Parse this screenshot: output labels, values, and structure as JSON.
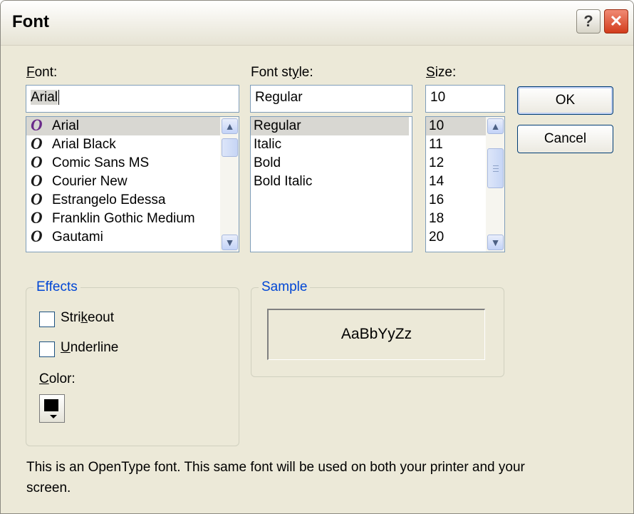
{
  "window": {
    "title": "Font",
    "help_glyph": "?",
    "close_glyph": "✕"
  },
  "font": {
    "label_mnemonic": "F",
    "label_rest": "ont:",
    "value": "Arial",
    "items": [
      "Arial",
      "Arial Black",
      "Comic Sans MS",
      "Courier New",
      "Estrangelo Edessa",
      "Franklin Gothic Medium",
      "Gautami"
    ],
    "selected": "Arial",
    "icon": "opentype-icon"
  },
  "font_style": {
    "label_pre": "Font st",
    "label_mnemonic": "y",
    "label_rest": "le:",
    "value": "Regular",
    "items": [
      "Regular",
      "Italic",
      "Bold",
      "Bold Italic"
    ],
    "selected": "Regular"
  },
  "size": {
    "label_mnemonic": "S",
    "label_rest": "ize:",
    "value": "10",
    "items": [
      "10",
      "11",
      "12",
      "14",
      "16",
      "18",
      "20"
    ],
    "selected": "10"
  },
  "buttons": {
    "ok": "OK",
    "cancel": "Cancel"
  },
  "effects": {
    "legend": "Effects",
    "strikeout_pre": "Stri",
    "strikeout_mnemonic": "k",
    "strikeout_rest": "eout",
    "underline_mnemonic": "U",
    "underline_rest": "nderline",
    "color_mnemonic": "C",
    "color_rest": "olor:",
    "color_value": "#000000"
  },
  "sample": {
    "legend": "Sample",
    "text": "AaBbYyZz"
  },
  "description": "This is an OpenType font. This same font will be used on both your printer and your screen.",
  "icons": {
    "scroll_up": "chevron-up-icon",
    "scroll_down": "chevron-down-icon"
  },
  "colors": {
    "accent": "#0046d5",
    "dialog_bg": "#ece9d8",
    "close": "#d23c1c"
  }
}
